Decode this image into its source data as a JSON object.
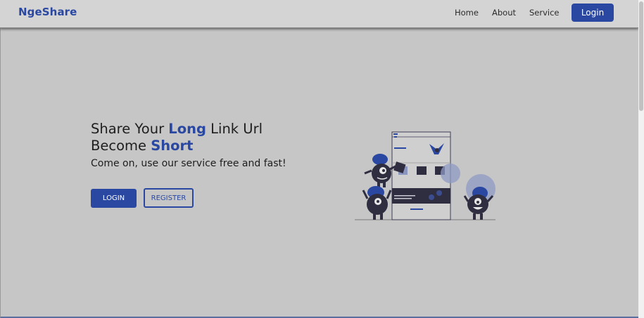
{
  "brand": {
    "name": "NgeShare"
  },
  "nav": {
    "items": [
      {
        "label": "Home"
      },
      {
        "label": "About"
      },
      {
        "label": "Service"
      }
    ],
    "login_label": "Login"
  },
  "hero": {
    "title_part1": "Share Your ",
    "title_accent1": "Long",
    "title_part2": " Link Url",
    "title_part3": "Become ",
    "title_accent2": "Short",
    "subtitle": "Come on, use our service free and fast!",
    "login_button": "LOGIN",
    "register_button": "REGISTER"
  },
  "colors": {
    "accent": "#2a48a2",
    "overlay_background": "#c6c6c6",
    "navbar": "#d4d4d4",
    "dark_figure": "#2f2e41"
  },
  "illustration": {
    "icon": "monsters-building-webpage-illustration"
  }
}
